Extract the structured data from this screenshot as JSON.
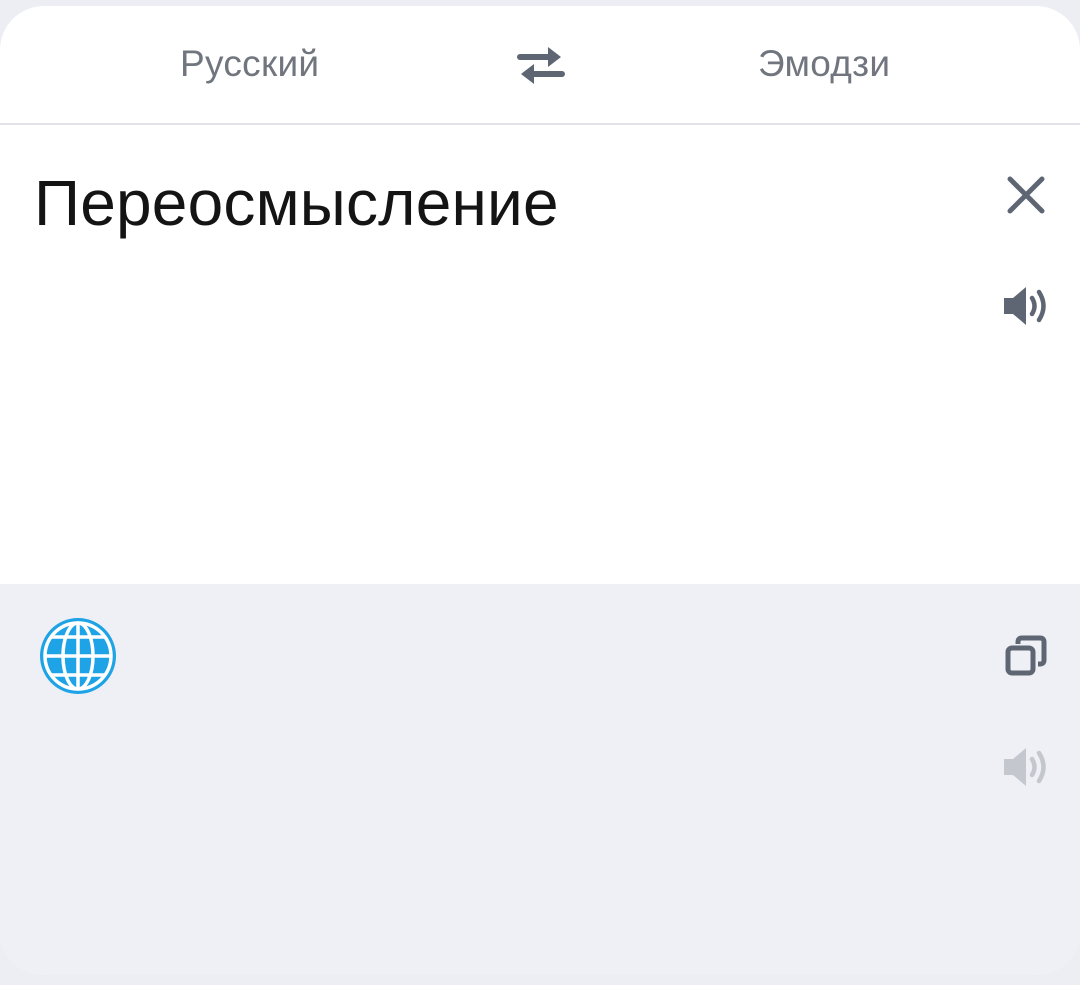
{
  "header": {
    "source_language": "Русский",
    "target_language": "Эмодзи",
    "swap_icon": "swap-arrows-icon"
  },
  "input": {
    "text": "Переосмысление",
    "clear_icon": "close-icon",
    "speak_icon": "speaker-icon"
  },
  "output": {
    "result_emoji": "🌐",
    "copy_icon": "copy-icon",
    "speak_icon": "speaker-icon",
    "speak_enabled": false
  },
  "colors": {
    "icon": "#5f6673",
    "icon_disabled": "#c4c7ce",
    "label": "#70757e",
    "output_bg": "#eff0f5",
    "globe": "#1ea3e6"
  }
}
